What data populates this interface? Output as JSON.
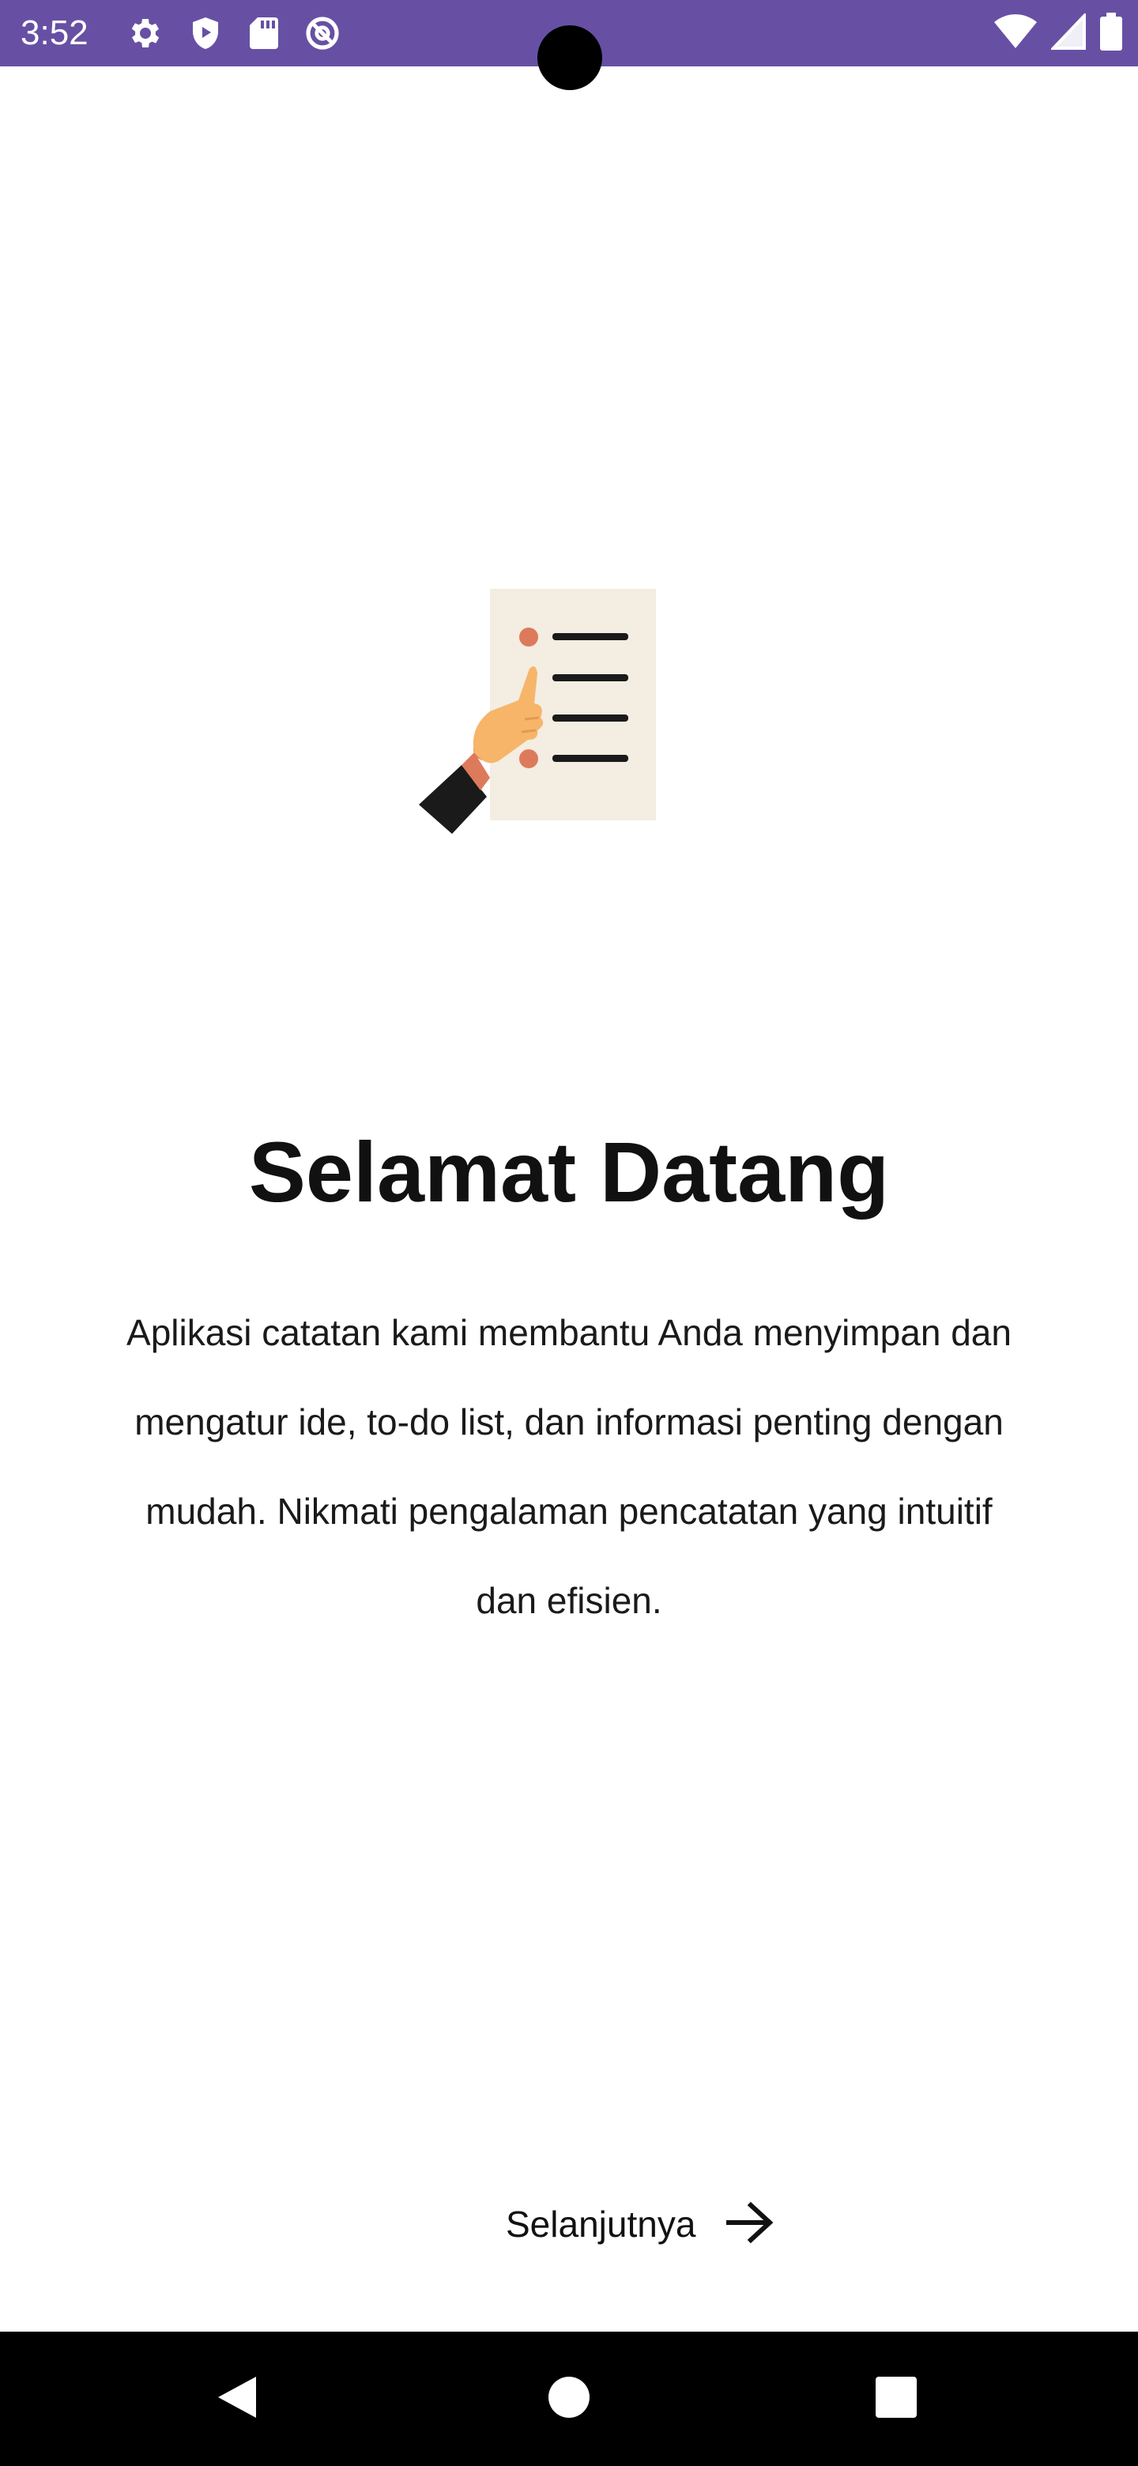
{
  "status_bar": {
    "time": "3:52",
    "background_color": "#6750a4",
    "left_icons": [
      "settings-icon",
      "shield-play-icon",
      "sd-card-icon",
      "at-sign-icon"
    ],
    "right_icons": [
      "wifi-icon",
      "cellular-signal-icon",
      "battery-icon"
    ]
  },
  "onboarding": {
    "illustration": "checklist-hand-pointing-illustration",
    "title": "Selamat Datang",
    "description_lines": [
      "Aplikasi catatan kami membantu Anda menyimpan dan",
      "mengatur ide, to-do list, dan informasi penting dengan",
      "mudah. Nikmati pengalaman pencatatan yang intuitif",
      "dan efisien."
    ],
    "next_label": "Selanjutnya",
    "next_icon": "arrow-right-icon"
  },
  "navigation_bar": {
    "buttons": [
      "back-icon",
      "home-icon",
      "recents-icon"
    ]
  }
}
